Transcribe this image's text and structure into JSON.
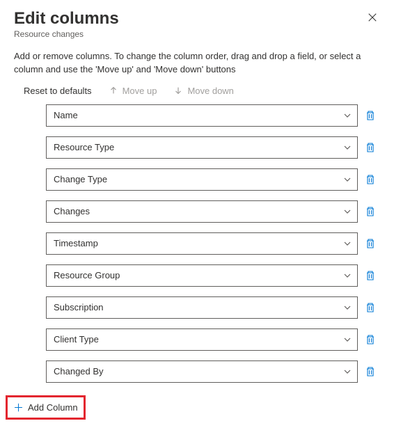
{
  "header": {
    "title": "Edit columns",
    "subtitle": "Resource changes"
  },
  "description": "Add or remove columns. To change the column order, drag and drop a field, or select a column and use the 'Move up' and 'Move down' buttons",
  "toolbar": {
    "reset": "Reset to defaults",
    "moveUp": "Move up",
    "moveDown": "Move down"
  },
  "columns": [
    {
      "label": "Name"
    },
    {
      "label": "Resource Type"
    },
    {
      "label": "Change Type"
    },
    {
      "label": "Changes"
    },
    {
      "label": "Timestamp"
    },
    {
      "label": "Resource Group"
    },
    {
      "label": "Subscription"
    },
    {
      "label": "Client Type"
    },
    {
      "label": "Changed By"
    }
  ],
  "addColumn": "Add Column"
}
